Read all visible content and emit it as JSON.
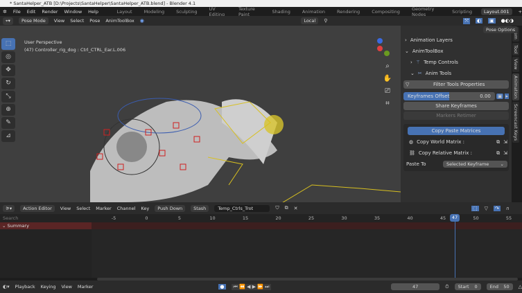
{
  "window": {
    "title": "* SantaHelper_ATB [D:\\Projects\\SantaHelper\\SantaHelper_ATB.blend] - Blender 4.1"
  },
  "menu": [
    "File",
    "Edit",
    "Render",
    "Window",
    "Help"
  ],
  "workspaces": [
    "Layout",
    "Modeling",
    "Sculpting",
    "UV Editing",
    "Texture Paint",
    "Shading",
    "Animation",
    "Rendering",
    "Compositing",
    "Geometry Nodes",
    "Scripting",
    "Layout.001"
  ],
  "active_workspace": "Layout.001",
  "viewport_header": {
    "mode": "Pose Mode",
    "items": [
      "View",
      "Select",
      "Pose",
      "AnimToolBox"
    ],
    "transform": "Local",
    "pose_options": "Pose Options"
  },
  "viewport": {
    "view": "User Perspective",
    "object": "(47) Controller_rig_dog : Ctrl_CTRL_Ear.L.006"
  },
  "npanel": {
    "animation_layers": "Animation Layers",
    "animtoolbox": "AnimToolBox",
    "temp_controls": "Temp Controls",
    "anim_tools": "Anim Tools",
    "filter": "Filter Tools Properties",
    "keyframes_offset_label": "Keyframes Offset",
    "keyframes_offset_value": "0.00",
    "share": "Share Keyframes",
    "markers": "Markers Retimer",
    "copy_paste": "Copy Paste Matrices",
    "copy_world": "Copy World Matrix :",
    "copy_relative": "Copy Relative Matrix :",
    "paste_to_label": "Paste To",
    "paste_to_value": "Selected Keyframe"
  },
  "tabs": [
    "Item",
    "Tool",
    "View",
    "Animation",
    "Screencast Keys"
  ],
  "timeline_header": {
    "editor": "Action Editor",
    "items": [
      "View",
      "Select",
      "Marker",
      "Channel",
      "Key"
    ],
    "push_down": "Push Down",
    "stash": "Stash",
    "action": "Temp_Ctrls_Trot"
  },
  "search_placeholder": "Search",
  "summary": "Summary",
  "ruler_ticks": [
    "-5",
    "0",
    "5",
    "10",
    "15",
    "20",
    "25",
    "30",
    "35",
    "40",
    "45",
    "50",
    "55"
  ],
  "current_frame": "47",
  "bottom": {
    "items": [
      "Playback",
      "Keying",
      "View",
      "Marker"
    ],
    "frame": "47",
    "start_label": "Start",
    "start": "0",
    "end_label": "End",
    "end": "50"
  },
  "colors": {
    "accent": "#4772b3",
    "summary": "#5a2525"
  }
}
